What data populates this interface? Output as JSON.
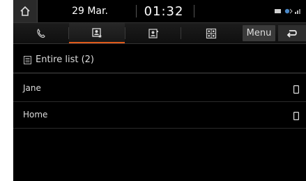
{
  "status_bar": {
    "date": "29 Mar.",
    "time": "01:32",
    "icons": [
      "home-icon",
      "bluetooth-icon",
      "signal-icon"
    ]
  },
  "tabs": {
    "items": [
      {
        "icon": "call-history-icon",
        "active": false
      },
      {
        "icon": "favorites-contact-icon",
        "active": true
      },
      {
        "icon": "contacts-icon",
        "active": false
      },
      {
        "icon": "dial-pad-icon",
        "active": false
      }
    ],
    "menu_label": "Menu",
    "back_icon": "back-arrow-icon"
  },
  "list": {
    "header_label": "Entire list (2)",
    "header_icon": "list-icon",
    "items": [
      {
        "name": "Jane",
        "icon": "mobile-phone-icon"
      },
      {
        "name": "Home",
        "icon": "mobile-phone-icon"
      }
    ]
  },
  "colors": {
    "accent": "#e05a1a",
    "background": "#000000",
    "text": "#dddddd"
  }
}
